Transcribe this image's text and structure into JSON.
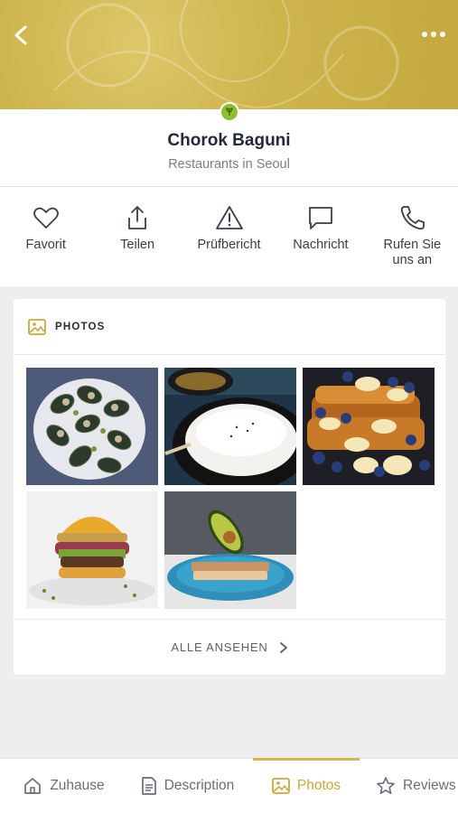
{
  "header": {
    "back_icon": "chevron-left-icon",
    "more_icon": "more-dots-icon",
    "badge_icon": "plant-badge-icon"
  },
  "profile": {
    "title": "Chorok Baguni",
    "subtitle": "Restaurants in Seoul"
  },
  "actions": [
    {
      "label": "Favorit",
      "icon": "heart-icon"
    },
    {
      "label": "Teilen",
      "icon": "share-icon"
    },
    {
      "label": "Prüfbericht",
      "icon": "warning-icon"
    },
    {
      "label": "Nachricht",
      "icon": "message-icon"
    },
    {
      "label": "Rufen Sie uns an",
      "icon": "phone-icon"
    }
  ],
  "photos": {
    "header": "PHOTOS",
    "header_icon": "image-icon",
    "items": [
      {
        "icon": "mussels-photo"
      },
      {
        "icon": "rice-bowl-photo"
      },
      {
        "icon": "french-toast-photo"
      },
      {
        "icon": "burger-photo"
      },
      {
        "icon": "avocado-toast-photo"
      }
    ],
    "see_all": "ALLE ANSEHEN"
  },
  "bottom_nav": [
    {
      "label": "Zuhause",
      "icon": "home-icon",
      "active": false
    },
    {
      "label": "Description",
      "icon": "document-icon",
      "active": false
    },
    {
      "label": "Photos",
      "icon": "image-icon",
      "active": true
    },
    {
      "label": "Reviews",
      "icon": "star-icon",
      "active": false
    }
  ],
  "colors": {
    "accent": "#d5b64e",
    "banner": "#cfb54e",
    "badge": "#8cbf2c"
  }
}
